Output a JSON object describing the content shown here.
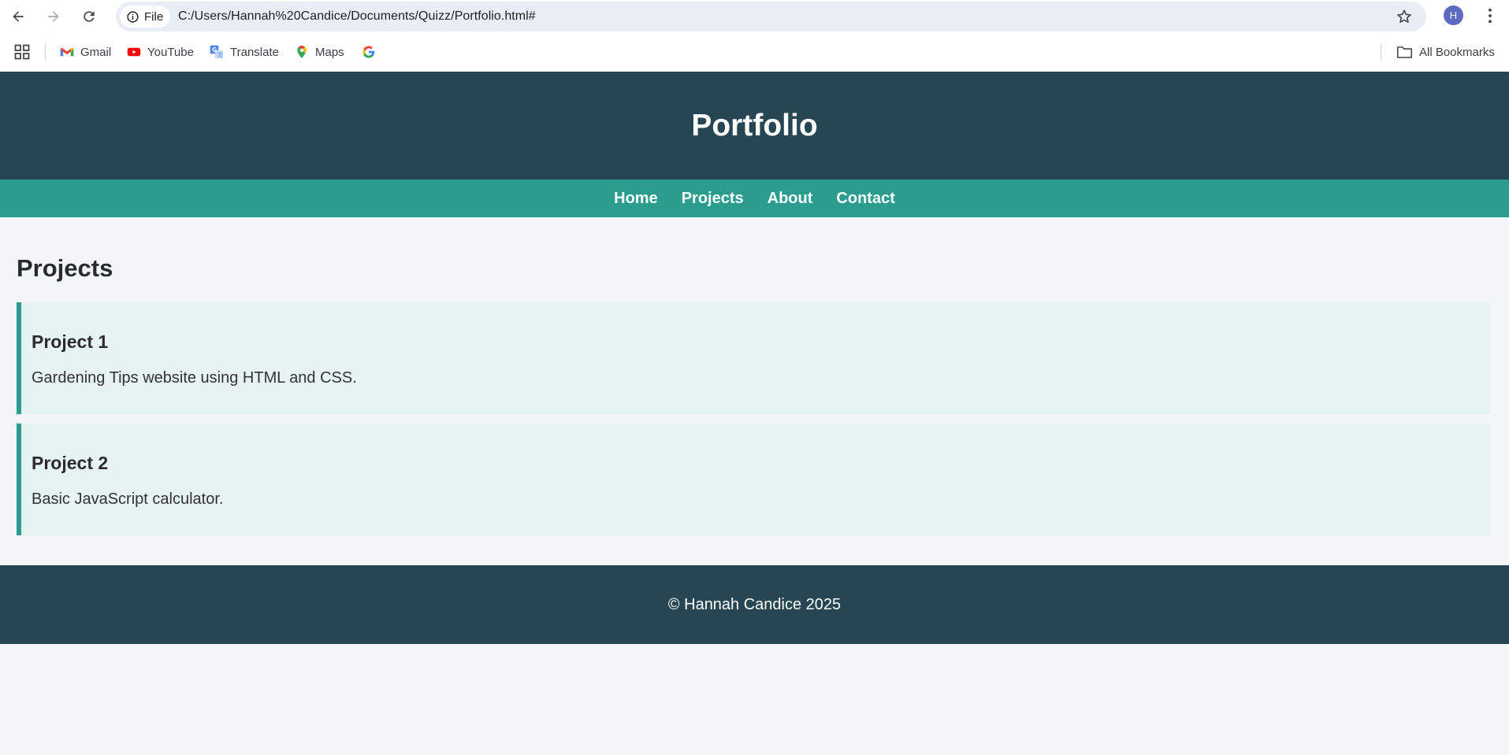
{
  "browser": {
    "site_chip_label": "File",
    "url": "C:/Users/Hannah%20Candice/Documents/Quizz/Portfolio.html#",
    "profile_initial": "H",
    "bookmarks": [
      {
        "label": "Gmail",
        "icon": "gmail-icon"
      },
      {
        "label": "YouTube",
        "icon": "youtube-icon"
      },
      {
        "label": "Translate",
        "icon": "translate-icon"
      },
      {
        "label": "Maps",
        "icon": "maps-icon"
      },
      {
        "label": "",
        "icon": "google-icon"
      }
    ],
    "all_bookmarks_label": "All Bookmarks"
  },
  "page": {
    "title": "Portfolio",
    "nav": [
      "Home",
      "Projects",
      "About",
      "Contact"
    ],
    "section_title": "Projects",
    "projects": [
      {
        "title": "Project 1",
        "description": "Gardening Tips website using HTML and CSS."
      },
      {
        "title": "Project 2",
        "description": "Basic JavaScript calculator."
      }
    ],
    "footer": "© Hannah Candice 2025"
  },
  "colors": {
    "header_bg": "#264653",
    "nav_bg": "#2a9d8f",
    "page_bg": "#f3f6f9",
    "card_bg": "#e6f3f1",
    "card_accent": "#2a9d8f"
  }
}
